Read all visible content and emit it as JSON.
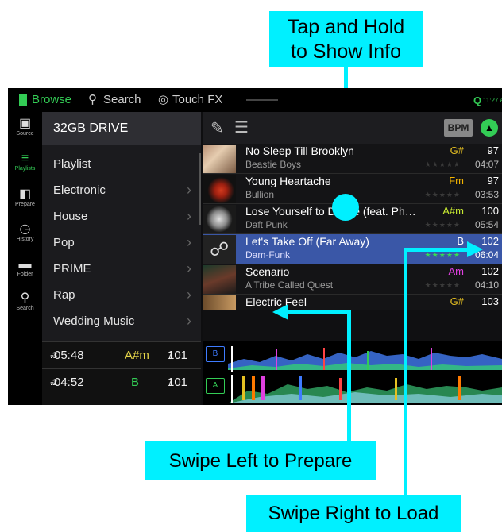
{
  "callouts": {
    "tap_hold": "Tap and Hold\nto Show Info",
    "swipe_left": "Swipe Left to Prepare",
    "swipe_right": "Swipe Right to Load"
  },
  "topbar": {
    "browse": "Browse",
    "search": "Search",
    "touch_fx": "Touch FX",
    "q": "Q",
    "time": "11:27 am"
  },
  "sidebar": {
    "items": [
      {
        "label": "Source",
        "icon": "usb-drive-icon"
      },
      {
        "label": "Playlists",
        "icon": "playlists-icon"
      },
      {
        "label": "Prepare",
        "icon": "prepare-icon"
      },
      {
        "label": "History",
        "icon": "history-icon"
      },
      {
        "label": "Folder",
        "icon": "folder-icon"
      },
      {
        "label": "Search",
        "icon": "search-icon"
      }
    ]
  },
  "left_panel": {
    "drive": "32GB DRIVE",
    "items": [
      "Playlist",
      "Electronic",
      "House",
      "Pop",
      "PRIME",
      "Rap",
      "Wedding Music"
    ]
  },
  "decks": [
    {
      "time": "-05:48",
      "time_dec": ".3",
      "key": "A#m",
      "bpm": "101",
      "bpm_dec": "7",
      "label": "B",
      "color": "#3e7bff",
      "key_color": "#e6d64a"
    },
    {
      "time": "-04:52",
      "time_dec": ".2",
      "key": "B",
      "bpm": "101",
      "bpm_dec": "7",
      "label": "A",
      "color": "#33cc55",
      "key_color": "#33cc55"
    }
  ],
  "toolbar": {
    "bpm_label": "BPM"
  },
  "tracks": [
    {
      "title": "No Sleep Till Brooklyn",
      "artist": "Beastie Boys",
      "key": "G#",
      "key_color": "#e6c022",
      "bpm": "97",
      "time": "04:07",
      "stars": "★★★★★"
    },
    {
      "title": "Young Heartache",
      "artist": "Bullion",
      "key": "Fm",
      "key_color": "#f2b300",
      "bpm": "97",
      "time": "03:53",
      "stars": "★★★★★"
    },
    {
      "title": "Lose Yourself to Dance (feat. Ph…",
      "artist": "Daft Punk",
      "key": "A#m",
      "key_color": "#c6e832",
      "bpm": "100",
      "time": "05:54",
      "stars": "★★★★★"
    },
    {
      "title": "Let's Take Off (Far Away)",
      "artist": "Dam-Funk",
      "key": "B",
      "key_color": "#ffffff",
      "bpm": "102",
      "time": "06:04",
      "stars": "★★★★★"
    },
    {
      "title": "Scenario",
      "artist": "A Tribe Called Quest",
      "key": "Am",
      "key_color": "#e040e0",
      "bpm": "102",
      "time": "04:10",
      "stars": "★★★★★"
    },
    {
      "title": "Electric Feel",
      "artist": "",
      "key": "G#",
      "key_color": "#e6c022",
      "bpm": "103",
      "time": "",
      "stars": ""
    }
  ],
  "colors": {
    "accent_green": "#33cc55",
    "selection_blue": "#3a57a7",
    "callout_cyan": "#00f0ff"
  }
}
